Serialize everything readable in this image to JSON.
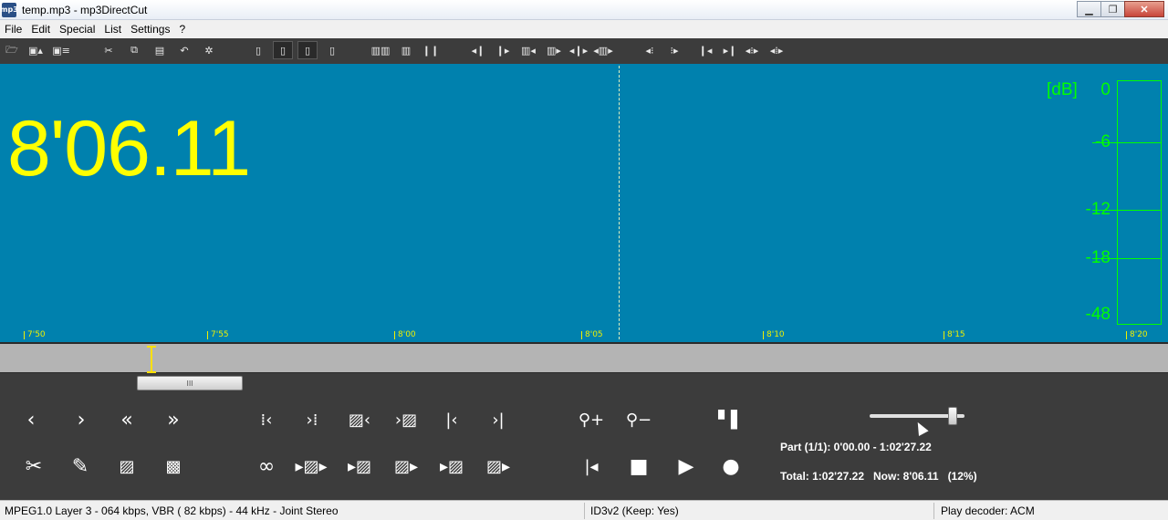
{
  "window": {
    "title": "temp.mp3 - mp3DirectCut",
    "icon_text": "mp3",
    "controls": {
      "minimize": "▁",
      "maximize": "❐",
      "close": "✕"
    }
  },
  "menu": [
    "File",
    "Edit",
    "Special",
    "List",
    "Settings",
    "?"
  ],
  "display": {
    "time": "8'06.11",
    "ticks": [
      "7'50",
      "7'55",
      "8'00",
      "8'05",
      "8'10",
      "8'15",
      "8'20"
    ],
    "db_unit": "[dB]",
    "db_labels": [
      "0",
      "-6",
      "-12",
      "-18",
      "-48"
    ],
    "colors": {
      "background": "#0081ae",
      "time": "#ffff00",
      "meter": "#00ff00"
    }
  },
  "scroll": {
    "thumb_grip": "III"
  },
  "info": {
    "part": "Part (1/1): 0'00.00 - 1:02'27.22",
    "total": "Total: 1:02'27.22   Now: 8'06.11   (12%)"
  },
  "volume": {
    "level": 0.92
  },
  "status": {
    "format": "MPEG1.0 Layer 3 - 064 kbps, VBR ( 82 kbps) - 44 kHz - Joint Stereo",
    "id3": "ID3v2 (Keep: Yes)",
    "decoder": "Play decoder: ACM"
  }
}
